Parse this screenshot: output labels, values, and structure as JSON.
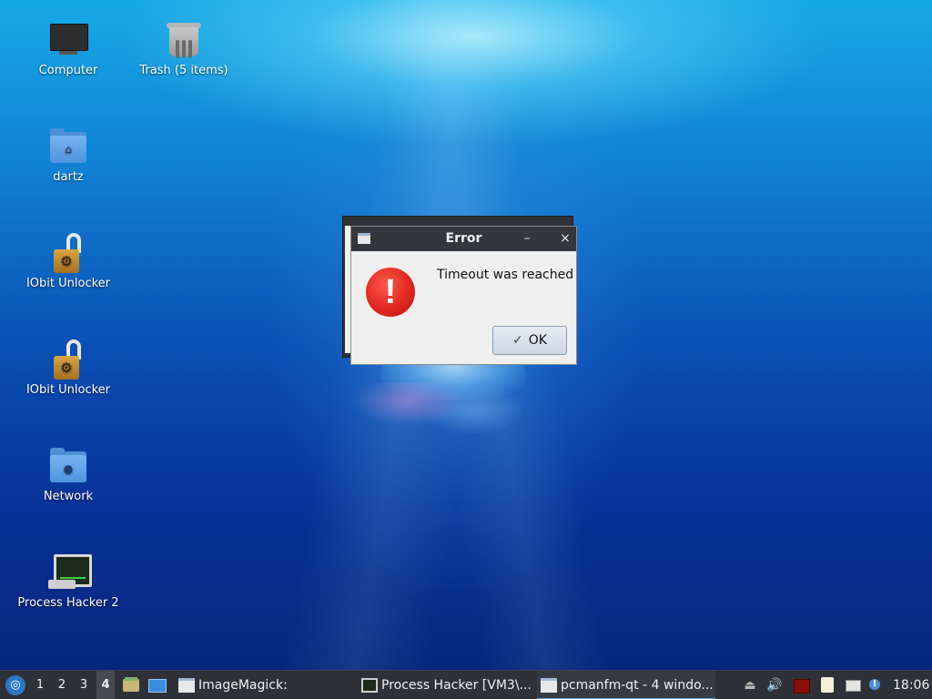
{
  "desktop": {
    "icons": [
      {
        "label": "Computer",
        "icon": "computer-icon"
      },
      {
        "label": "Trash (5 items)",
        "icon": "trash-icon"
      },
      {
        "label": "dartz",
        "icon": "home-folder-icon"
      },
      {
        "label": "IObit Unlocker",
        "icon": "unlocker-icon"
      },
      {
        "label": "IObit Unlocker",
        "icon": "unlocker-icon"
      },
      {
        "label": "Network",
        "icon": "network-folder-icon"
      },
      {
        "label": "Process Hacker 2",
        "icon": "process-hacker-icon"
      }
    ]
  },
  "dialog": {
    "title": "Error",
    "minimize_glyph": "–",
    "close_glyph": "×",
    "message": "Timeout was reached",
    "icon": "error-icon",
    "error_glyph": "!",
    "ok_label": "OK",
    "ok_check": "✓"
  },
  "taskbar": {
    "start_glyph": "◎",
    "workspaces": [
      "1",
      "2",
      "3",
      "4"
    ],
    "active_workspace": "4",
    "tasks": [
      {
        "label": "ImageMagick:",
        "icon": "window-icon"
      },
      {
        "label": "Process Hacker [VM3\\...",
        "icon": "process-hacker-icon"
      },
      {
        "label": "pcmanfm-qt - 4 windo...",
        "icon": "window-icon",
        "active": true
      }
    ],
    "tray": {
      "eject_glyph": "⏏",
      "volume_glyph": "🔊",
      "info_glyph": "!",
      "clock": "18:06"
    }
  },
  "colors": {
    "accent": "#5b9bd5",
    "error_red": "#e0271f",
    "titlebar": "#33363b",
    "taskbar": "#2e3238"
  }
}
